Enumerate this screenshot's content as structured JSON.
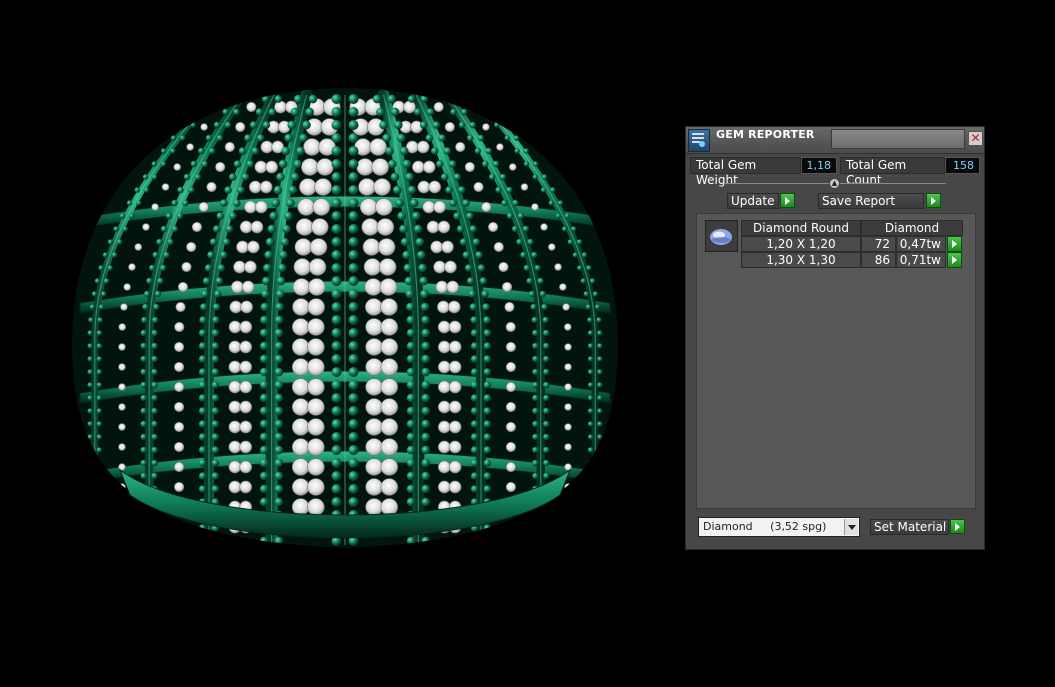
{
  "panel": {
    "title": "GEM REPORTER",
    "close_label": "✕",
    "total_gem_weight_label": "Total Gem Weight",
    "total_gem_weight_value": "1,18",
    "total_gem_count_label": "Total Gem Count",
    "total_gem_count_value": "158",
    "update_label": "Update",
    "save_report_label": "Save Report",
    "table": {
      "header_left": "Diamond Round",
      "header_right": "Diamond",
      "rows": [
        {
          "size": "1,20 X 1,20",
          "count": "72",
          "weight": "0,47tw"
        },
        {
          "size": "1,30 X 1,30",
          "count": "86",
          "weight": "0,71tw"
        }
      ]
    },
    "material_selected": "Diamond     (3,52 spg)",
    "set_material_label": "Set Material"
  },
  "colors": {
    "metal": "#0f7a56",
    "gem": "#ffffff",
    "value_text": "#7ecfff",
    "play_button": "#2ea82e"
  },
  "icons": [
    "gem-reporter-icon",
    "close-icon",
    "chevron-up-icon",
    "play-icon",
    "gem-thumbnail-icon",
    "dropdown-arrow-icon"
  ]
}
